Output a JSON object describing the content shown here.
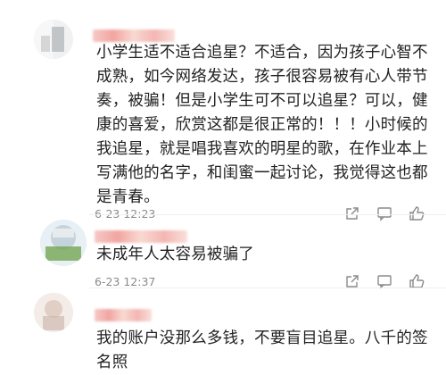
{
  "comments": [
    {
      "text": "小学生适不适合追星？不适合，因为孩子心智不成熟，如今网络发达，孩子很容易被有心人带节奏，被骗！但是小学生可不可以追星？可以，健康的喜爱，欣赏这都是很正常的！！！小时候的我追星，就是唱我喜欢的明星的歌，在作业本上写满他的名字，和闺蜜一起讨论，我觉得这也都是青春。",
      "time": "6-23 12:23",
      "actions": [
        "share-icon",
        "comment-icon",
        "like-icon"
      ]
    },
    {
      "text": "未成年人太容易被骗了",
      "time": "6-23 12:37",
      "actions": [
        "share-icon",
        "comment-icon",
        "like-icon"
      ]
    },
    {
      "text": "我的账户没那么多钱，不要盲目追星。八千的签名照",
      "time": "",
      "actions": []
    }
  ],
  "colors": {
    "text": "#222222",
    "meta": "#8a8a8a",
    "blurred_name": "#f1a5a1"
  }
}
